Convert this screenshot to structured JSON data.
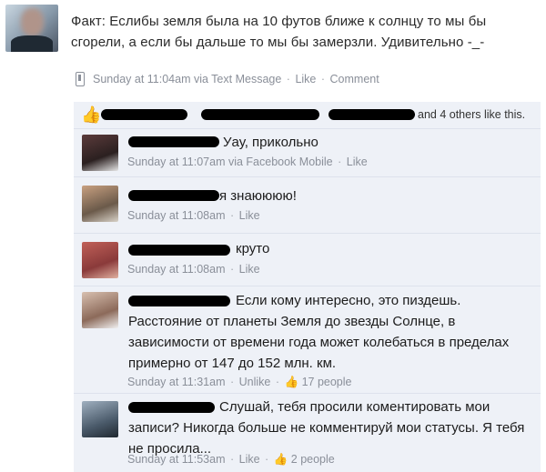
{
  "post": {
    "text": "Факт: Еслибы земля была на 10 футов ближе к солнцу то мы бы сгорели, а если бы дальше то мы бы замерзли. Удивительно -_-",
    "meta_time": "Sunday at 11:04am via Text Message",
    "like_link": "Like",
    "comment_link": "Comment"
  },
  "likes": {
    "text": "and 4 others like this."
  },
  "comments": [
    {
      "text": "Уау, прикольно",
      "meta": "Sunday at 11:07am via Facebook Mobile",
      "like": "Like"
    },
    {
      "text": "я знаюююю!",
      "meta": "Sunday at 11:08am",
      "like": "Like"
    },
    {
      "text": "круто",
      "meta": "Sunday at 11:08am",
      "like": "Like"
    },
    {
      "text": "Если кому интересно, это пиздешь. Расстояние от планеты Земля до звезды Солнце, в зависимости от времени года может колебаться в пределах примерно от 147 до 152 млн. км.",
      "meta": "Sunday at 11:31am",
      "like": "Unlike",
      "likes_count": "17 people"
    },
    {
      "text": "Слушай, тебя просили коментировать мои записи? Никогда больше не комментируй мои статусы. Я тебя не просила...",
      "meta": "Sunday at 11:53am",
      "like": "Like",
      "likes_count": "2 people"
    }
  ],
  "colors": {
    "feed_bg": "#eef1f7",
    "meta": "#8a8f99",
    "redaction": "#000000"
  }
}
